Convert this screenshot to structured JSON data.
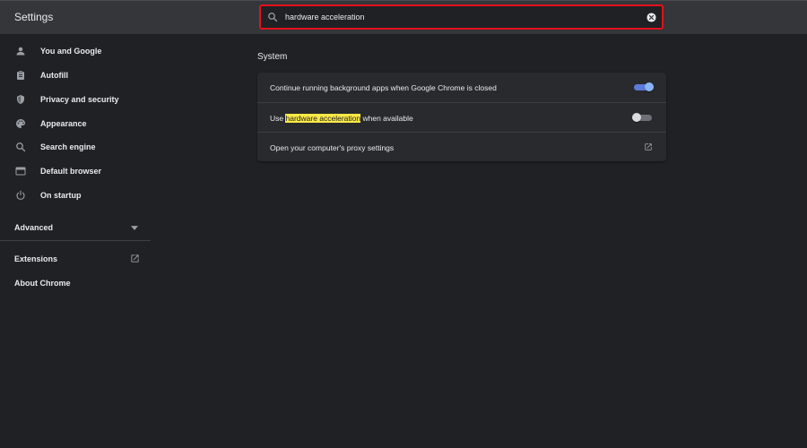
{
  "header": {
    "title": "Settings"
  },
  "search": {
    "value": "hardware acceleration",
    "placeholder": "Search settings"
  },
  "sidebar": {
    "items": [
      {
        "label": "You and Google",
        "icon": "person-icon"
      },
      {
        "label": "Autofill",
        "icon": "clipboard-icon"
      },
      {
        "label": "Privacy and security",
        "icon": "shield-icon"
      },
      {
        "label": "Appearance",
        "icon": "palette-icon"
      },
      {
        "label": "Search engine",
        "icon": "search-icon"
      },
      {
        "label": "Default browser",
        "icon": "browser-icon"
      },
      {
        "label": "On startup",
        "icon": "power-icon"
      }
    ],
    "advanced": "Advanced",
    "extensions": "Extensions",
    "about": "About Chrome"
  },
  "main": {
    "section_title": "System",
    "rows": [
      {
        "text": "Continue running background apps when Google Chrome is closed",
        "toggle": "on"
      },
      {
        "prefix": "Use ",
        "highlight": "hardware acceleration",
        "suffix": " when available",
        "toggle": "off"
      },
      {
        "text": "Open your computer's proxy settings",
        "icon": "open-in-new-icon"
      }
    ]
  },
  "colors": {
    "background": "#202124",
    "toolbar": "#35363a",
    "card": "#292a2d",
    "accent": "#8ab4f8",
    "highlight": "#fce946",
    "search_border": "#e3111b"
  }
}
